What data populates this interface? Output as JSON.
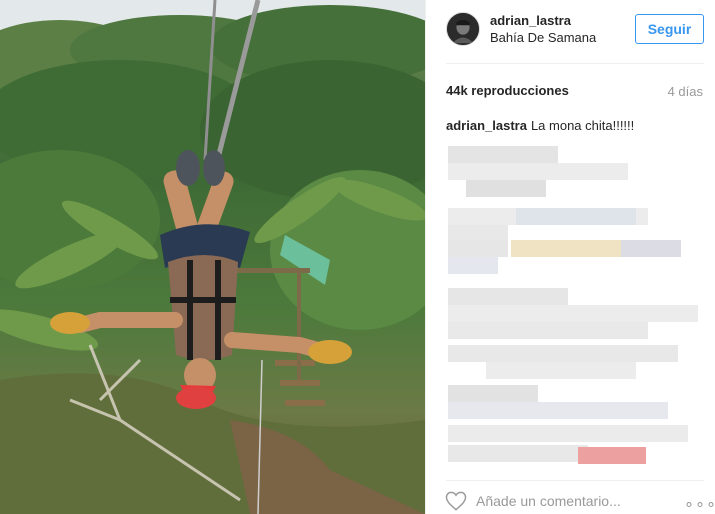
{
  "post": {
    "username": "adrian_lastra",
    "location": "Bahía De Samana",
    "follow_label": "Seguir",
    "views": "44k reproducciones",
    "time_ago": "4 días",
    "caption_user": "adrian_lastra",
    "caption_text": "La mona chita!!!!!!",
    "comment_placeholder": "Añade un comentario...",
    "more_label": "∘∘∘"
  },
  "colors": {
    "accent": "#3897f0",
    "text": "#262626",
    "muted": "#999999",
    "divider": "#efefef"
  },
  "icons": {
    "heart": "heart-icon",
    "more": "more-options-icon",
    "avatar": "avatar"
  }
}
